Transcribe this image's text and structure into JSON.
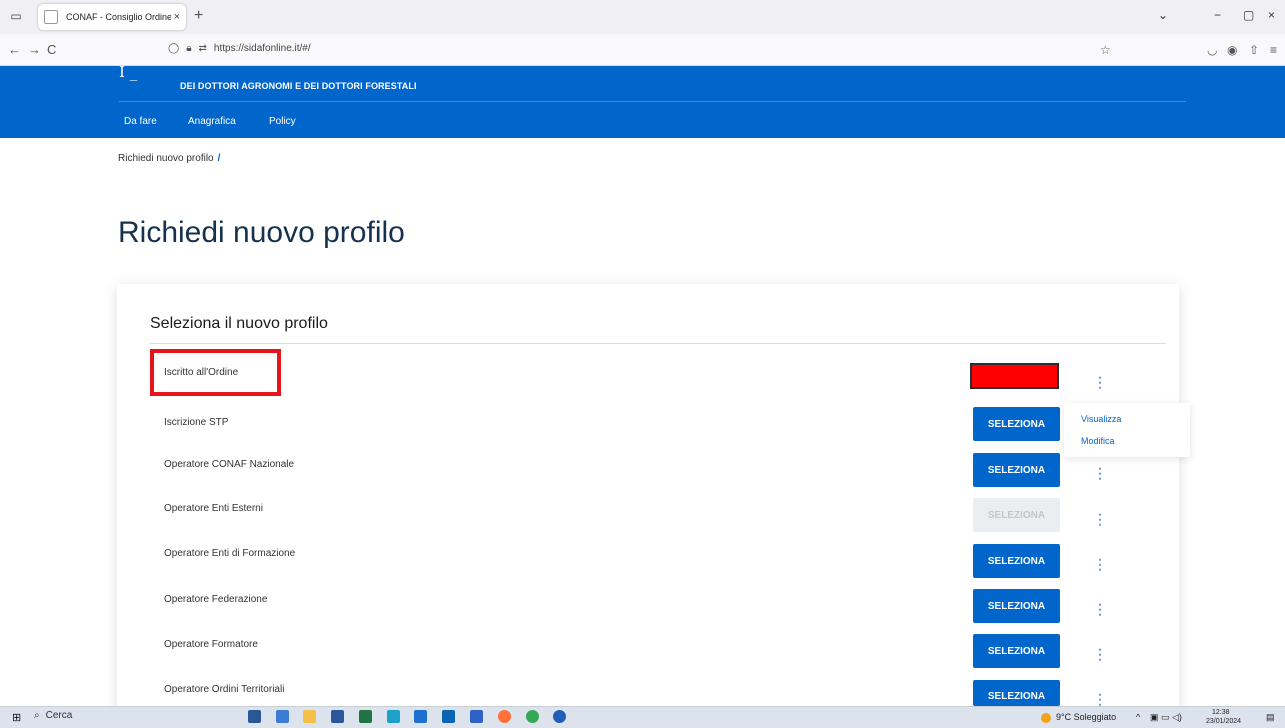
{
  "browser": {
    "tab_title": "CONAF - Consiglio Ordine Naz",
    "tab_close": "×",
    "new_tab": "+",
    "url": "https://sidafonline.it/#/",
    "nav_back": "←",
    "nav_forward": "→",
    "nav_reload": "C",
    "window_minimize": "−",
    "window_restore": "▢",
    "window_close": "×",
    "tab_menu": "⌄"
  },
  "site": {
    "logo_glyph": "I _",
    "org_name": "DEI DOTTORI AGRONOMI E DEI DOTTORI FORESTALI",
    "menu": [
      "Da fare",
      "Anagrafica",
      "Policy"
    ],
    "header_color": "#0066cc"
  },
  "breadcrumb": {
    "item": "Richiedi nuovo profilo",
    "separator": "/"
  },
  "page": {
    "title": "Richiedi nuovo profilo",
    "card_title": "Seleziona il nuovo profilo"
  },
  "profiles": [
    {
      "label": "Iscritto all'Ordine",
      "button": "",
      "state": "redacted",
      "highlighted": true
    },
    {
      "label": "Iscrizione STP",
      "button": "SELEZIONA",
      "state": "enabled"
    },
    {
      "label": "Operatore CONAF Nazionale",
      "button": "SELEZIONA",
      "state": "enabled"
    },
    {
      "label": "Operatore Enti Esterni",
      "button": "SELEZIONA",
      "state": "disabled"
    },
    {
      "label": "Operatore Enti di Formazione",
      "button": "SELEZIONA",
      "state": "enabled"
    },
    {
      "label": "Operatore Federazione",
      "button": "SELEZIONA",
      "state": "enabled"
    },
    {
      "label": "Operatore Formatore",
      "button": "SELEZIONA",
      "state": "enabled"
    },
    {
      "label": "Operatore Ordini Territoriali",
      "button": "SELEZIONA",
      "state": "enabled"
    }
  ],
  "kebab_glyph": "⋮",
  "dropdown": {
    "items": [
      "Visualizza",
      "Modifica"
    ]
  },
  "taskbar": {
    "search_label": "Cerca",
    "weather": "9°C Soleggiato",
    "time": "12:38",
    "date": "23/01/2024"
  },
  "colors": {
    "accent": "#0066cc",
    "highlight": "#e8141b",
    "redacted": "#ff0000"
  }
}
